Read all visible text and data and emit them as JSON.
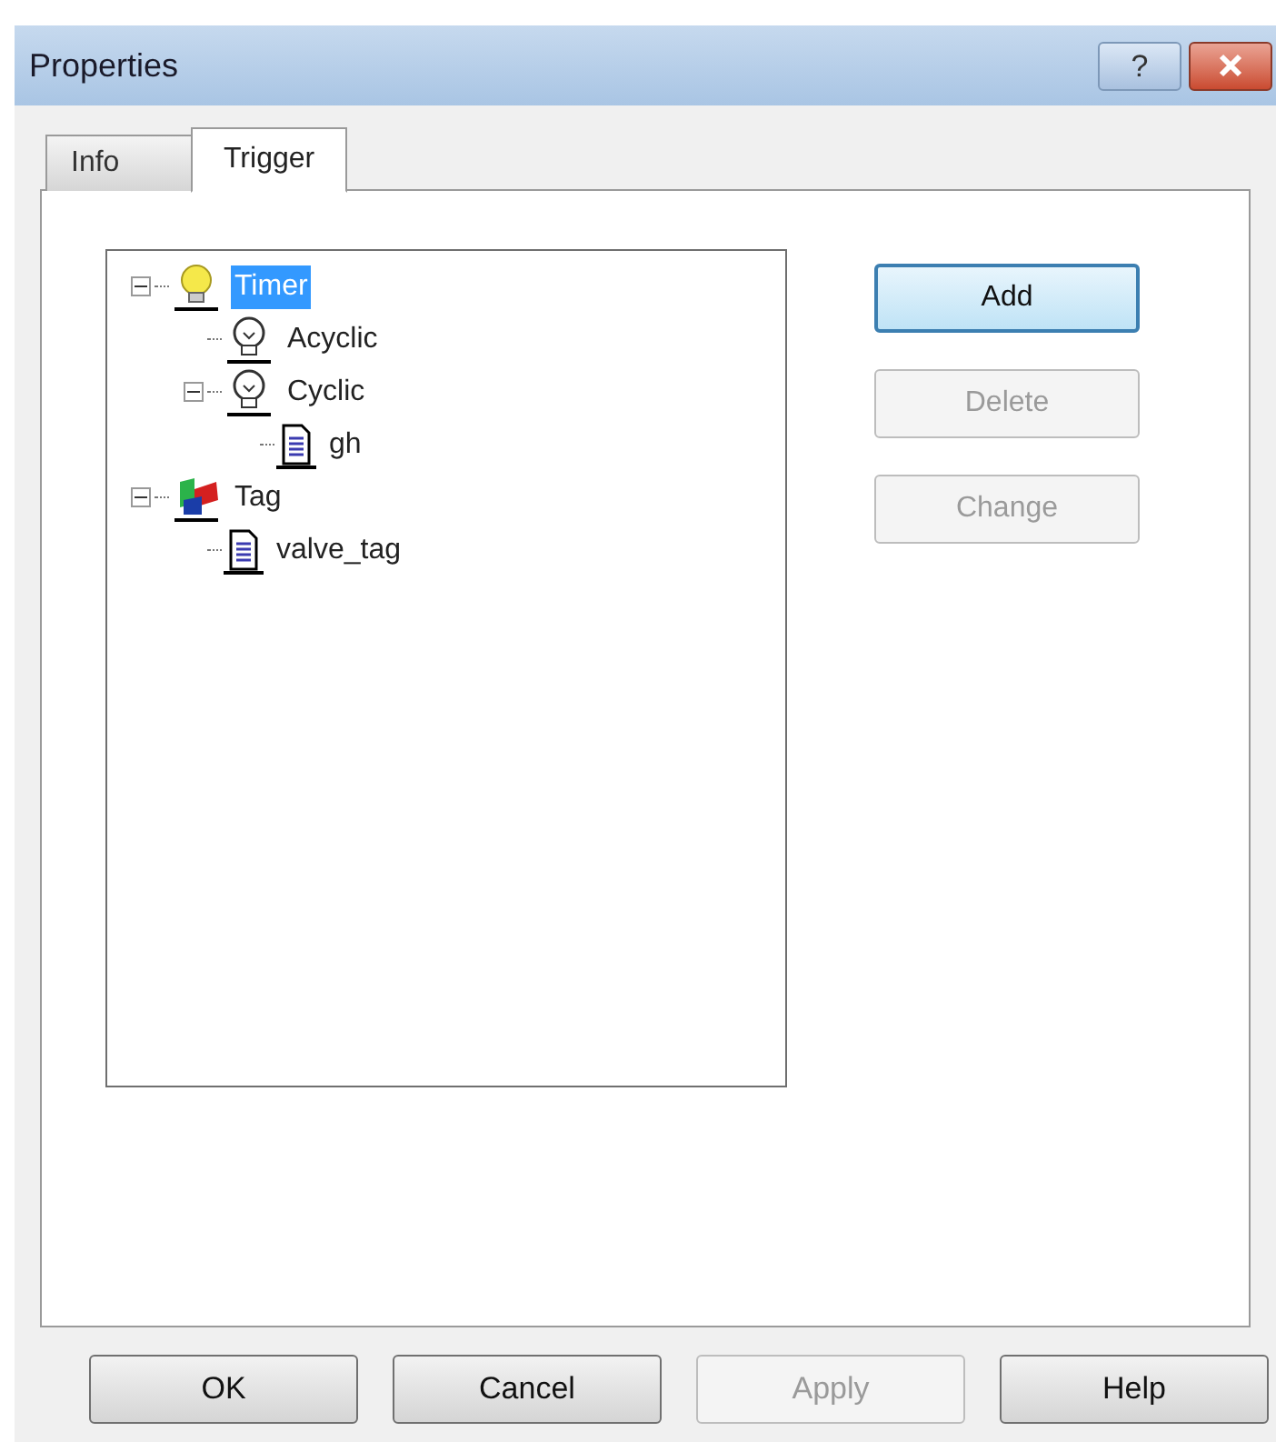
{
  "window": {
    "title": "Properties"
  },
  "title_buttons": [
    {
      "kind": "help",
      "label": "?"
    },
    {
      "kind": "close"
    }
  ],
  "tabs": [
    {
      "label": "Info",
      "selected": false
    },
    {
      "label": "Trigger",
      "selected": true
    }
  ],
  "tree": [
    {
      "label": "Timer",
      "kind": "timer",
      "selected": true,
      "expanded": true,
      "children": [
        {
          "label": "Acyclic",
          "kind": "bulb",
          "selected": false
        },
        {
          "label": "Cyclic",
          "kind": "bulb",
          "selected": false,
          "expanded": true,
          "children": [
            {
              "label": "gh",
              "kind": "doc",
              "selected": false
            }
          ]
        }
      ]
    },
    {
      "label": "Tag",
      "kind": "tag",
      "selected": false,
      "expanded": true,
      "children": [
        {
          "label": "valve_tag",
          "kind": "doc",
          "selected": false
        }
      ]
    }
  ],
  "side_buttons": [
    {
      "label": "Add",
      "disabled": false,
      "default": true
    },
    {
      "label": "Delete",
      "disabled": true
    },
    {
      "label": "Change",
      "disabled": true
    }
  ],
  "dialog_buttons": [
    {
      "label": "OK",
      "disabled": false
    },
    {
      "label": "Cancel",
      "disabled": false
    },
    {
      "label": "Apply",
      "disabled": true
    },
    {
      "label": "Help",
      "disabled": false
    }
  ]
}
